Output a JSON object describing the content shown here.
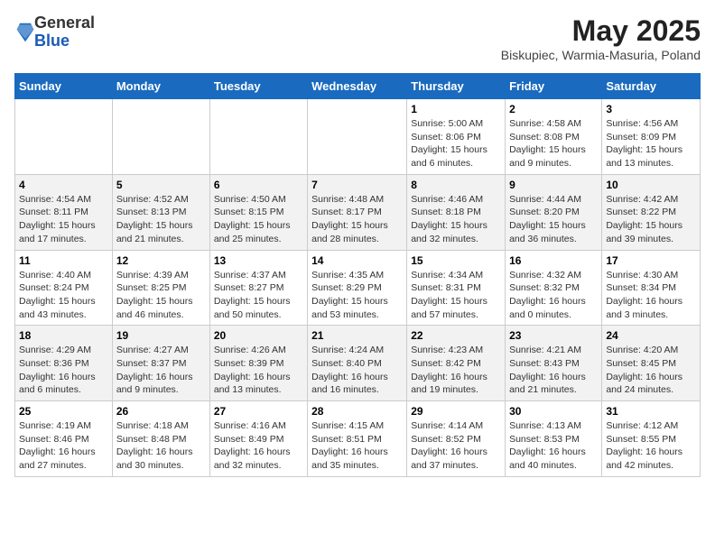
{
  "header": {
    "logo_general": "General",
    "logo_blue": "Blue",
    "month_title": "May 2025",
    "location": "Biskupiec, Warmia-Masuria, Poland"
  },
  "weekdays": [
    "Sunday",
    "Monday",
    "Tuesday",
    "Wednesday",
    "Thursday",
    "Friday",
    "Saturday"
  ],
  "weeks": [
    [
      {
        "day": "",
        "info": ""
      },
      {
        "day": "",
        "info": ""
      },
      {
        "day": "",
        "info": ""
      },
      {
        "day": "",
        "info": ""
      },
      {
        "day": "1",
        "info": "Sunrise: 5:00 AM\nSunset: 8:06 PM\nDaylight: 15 hours\nand 6 minutes."
      },
      {
        "day": "2",
        "info": "Sunrise: 4:58 AM\nSunset: 8:08 PM\nDaylight: 15 hours\nand 9 minutes."
      },
      {
        "day": "3",
        "info": "Sunrise: 4:56 AM\nSunset: 8:09 PM\nDaylight: 15 hours\nand 13 minutes."
      }
    ],
    [
      {
        "day": "4",
        "info": "Sunrise: 4:54 AM\nSunset: 8:11 PM\nDaylight: 15 hours\nand 17 minutes."
      },
      {
        "day": "5",
        "info": "Sunrise: 4:52 AM\nSunset: 8:13 PM\nDaylight: 15 hours\nand 21 minutes."
      },
      {
        "day": "6",
        "info": "Sunrise: 4:50 AM\nSunset: 8:15 PM\nDaylight: 15 hours\nand 25 minutes."
      },
      {
        "day": "7",
        "info": "Sunrise: 4:48 AM\nSunset: 8:17 PM\nDaylight: 15 hours\nand 28 minutes."
      },
      {
        "day": "8",
        "info": "Sunrise: 4:46 AM\nSunset: 8:18 PM\nDaylight: 15 hours\nand 32 minutes."
      },
      {
        "day": "9",
        "info": "Sunrise: 4:44 AM\nSunset: 8:20 PM\nDaylight: 15 hours\nand 36 minutes."
      },
      {
        "day": "10",
        "info": "Sunrise: 4:42 AM\nSunset: 8:22 PM\nDaylight: 15 hours\nand 39 minutes."
      }
    ],
    [
      {
        "day": "11",
        "info": "Sunrise: 4:40 AM\nSunset: 8:24 PM\nDaylight: 15 hours\nand 43 minutes."
      },
      {
        "day": "12",
        "info": "Sunrise: 4:39 AM\nSunset: 8:25 PM\nDaylight: 15 hours\nand 46 minutes."
      },
      {
        "day": "13",
        "info": "Sunrise: 4:37 AM\nSunset: 8:27 PM\nDaylight: 15 hours\nand 50 minutes."
      },
      {
        "day": "14",
        "info": "Sunrise: 4:35 AM\nSunset: 8:29 PM\nDaylight: 15 hours\nand 53 minutes."
      },
      {
        "day": "15",
        "info": "Sunrise: 4:34 AM\nSunset: 8:31 PM\nDaylight: 15 hours\nand 57 minutes."
      },
      {
        "day": "16",
        "info": "Sunrise: 4:32 AM\nSunset: 8:32 PM\nDaylight: 16 hours\nand 0 minutes."
      },
      {
        "day": "17",
        "info": "Sunrise: 4:30 AM\nSunset: 8:34 PM\nDaylight: 16 hours\nand 3 minutes."
      }
    ],
    [
      {
        "day": "18",
        "info": "Sunrise: 4:29 AM\nSunset: 8:36 PM\nDaylight: 16 hours\nand 6 minutes."
      },
      {
        "day": "19",
        "info": "Sunrise: 4:27 AM\nSunset: 8:37 PM\nDaylight: 16 hours\nand 9 minutes."
      },
      {
        "day": "20",
        "info": "Sunrise: 4:26 AM\nSunset: 8:39 PM\nDaylight: 16 hours\nand 13 minutes."
      },
      {
        "day": "21",
        "info": "Sunrise: 4:24 AM\nSunset: 8:40 PM\nDaylight: 16 hours\nand 16 minutes."
      },
      {
        "day": "22",
        "info": "Sunrise: 4:23 AM\nSunset: 8:42 PM\nDaylight: 16 hours\nand 19 minutes."
      },
      {
        "day": "23",
        "info": "Sunrise: 4:21 AM\nSunset: 8:43 PM\nDaylight: 16 hours\nand 21 minutes."
      },
      {
        "day": "24",
        "info": "Sunrise: 4:20 AM\nSunset: 8:45 PM\nDaylight: 16 hours\nand 24 minutes."
      }
    ],
    [
      {
        "day": "25",
        "info": "Sunrise: 4:19 AM\nSunset: 8:46 PM\nDaylight: 16 hours\nand 27 minutes."
      },
      {
        "day": "26",
        "info": "Sunrise: 4:18 AM\nSunset: 8:48 PM\nDaylight: 16 hours\nand 30 minutes."
      },
      {
        "day": "27",
        "info": "Sunrise: 4:16 AM\nSunset: 8:49 PM\nDaylight: 16 hours\nand 32 minutes."
      },
      {
        "day": "28",
        "info": "Sunrise: 4:15 AM\nSunset: 8:51 PM\nDaylight: 16 hours\nand 35 minutes."
      },
      {
        "day": "29",
        "info": "Sunrise: 4:14 AM\nSunset: 8:52 PM\nDaylight: 16 hours\nand 37 minutes."
      },
      {
        "day": "30",
        "info": "Sunrise: 4:13 AM\nSunset: 8:53 PM\nDaylight: 16 hours\nand 40 minutes."
      },
      {
        "day": "31",
        "info": "Sunrise: 4:12 AM\nSunset: 8:55 PM\nDaylight: 16 hours\nand 42 minutes."
      }
    ]
  ]
}
